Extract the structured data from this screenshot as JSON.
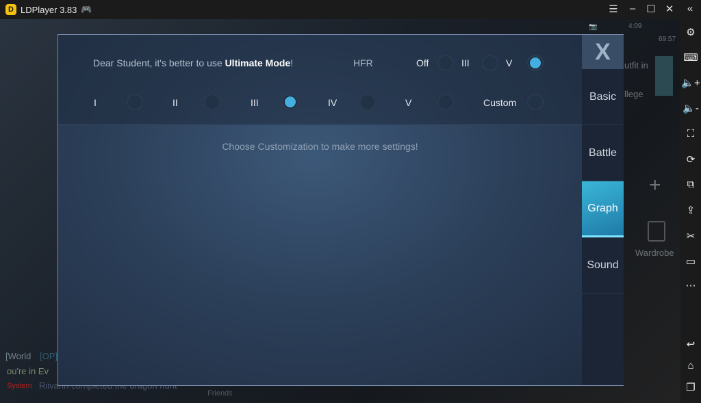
{
  "window": {
    "title": "LDPlayer 3.83",
    "menu": "☰",
    "minimize": "–",
    "maximize": "☐",
    "close": "✕",
    "collapse": "«"
  },
  "status": {
    "time": "4:09",
    "fps": "69.57"
  },
  "game_bg": {
    "outfit": "utfit in",
    "college": "llege",
    "wardrobe": "Wardrobe",
    "world": "[World",
    "op": "[OP]",
    "event": "ou're in Ev",
    "system": "System",
    "system_msg": "Riivann completed the dragon hunt",
    "friends": "Friends",
    "plus": "+"
  },
  "dialog": {
    "notice_prefix": "Dear Student, it's better to use ",
    "notice_bold": "Ultimate Mode",
    "notice_suffix": "!",
    "hfr_label": "HFR",
    "hfr_options": [
      {
        "label": "Off",
        "selected": false
      },
      {
        "label": "III",
        "selected": false
      },
      {
        "label": "V",
        "selected": true
      }
    ],
    "quality_options": [
      {
        "label": "I",
        "selected": false
      },
      {
        "label": "II",
        "selected": false
      },
      {
        "label": "III",
        "selected": true
      },
      {
        "label": "IV",
        "selected": false
      },
      {
        "label": "V",
        "selected": false
      },
      {
        "label": "Custom",
        "selected": false
      }
    ],
    "hint": "Choose Customization to make more settings!",
    "close": "X",
    "tabs": [
      {
        "label": "Basic"
      },
      {
        "label": "Battle"
      },
      {
        "label": "Graph",
        "active": true
      },
      {
        "label": "Sound"
      }
    ]
  },
  "accent": "#45aee0",
  "sidebar_icons": [
    "settings-icon",
    "keyboard-icon",
    "volume-up-icon",
    "volume-down-icon",
    "fullscreen-icon",
    "sync-icon",
    "multi-instance-icon",
    "apk-install-icon",
    "scissors-icon",
    "record-video-icon",
    "more-icon",
    "back-icon",
    "home-icon",
    "recent-apps-icon"
  ]
}
